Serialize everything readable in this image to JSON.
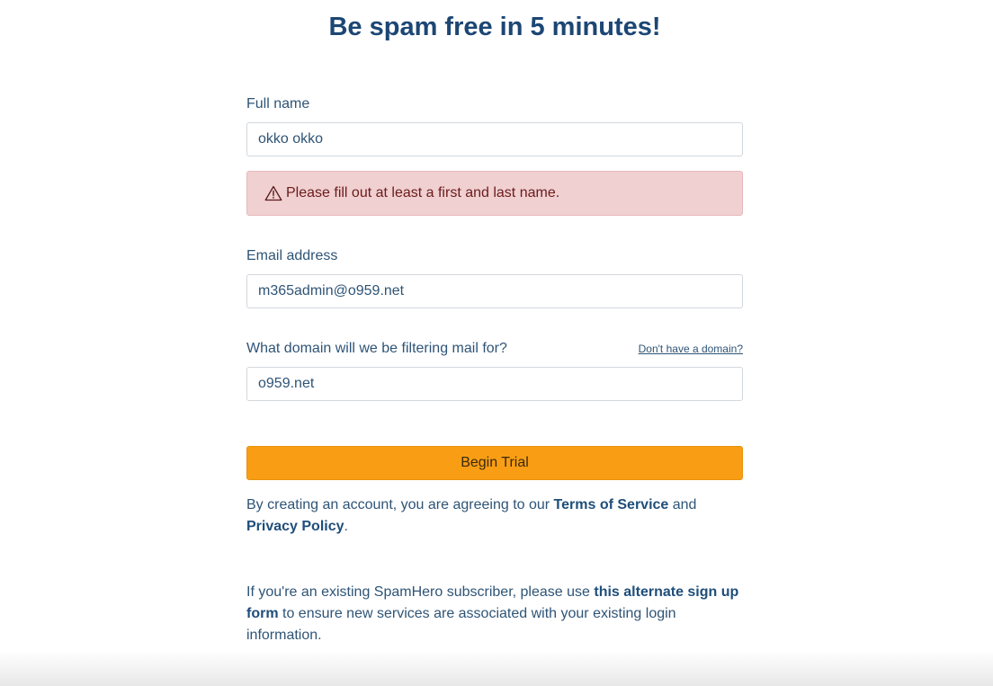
{
  "page": {
    "title": "Be spam free in 5 minutes!"
  },
  "form": {
    "full_name": {
      "label": "Full name",
      "value": "okko okko"
    },
    "name_error": {
      "icon": "warning-icon",
      "message": "Please fill out at least a first and last name."
    },
    "email": {
      "label": "Email address",
      "value": "m365admin@o959.net"
    },
    "domain": {
      "label": "What domain will we be filtering mail for?",
      "help_link": "Don't have a domain?",
      "value": "o959.net"
    },
    "submit_label": "Begin Trial"
  },
  "agreement": {
    "prefix": "By creating an account, you are agreeing to our ",
    "terms_link": "Terms of Service",
    "middle": " and ",
    "privacy_link": "Privacy Policy",
    "suffix": "."
  },
  "existing": {
    "prefix": "If you're an existing SpamHero subscriber, please use ",
    "link": "this alternate sign up form",
    "suffix": " to ensure new services are associated with your existing login information."
  },
  "colors": {
    "title": "#1c4674",
    "button": "#f99e14",
    "alert_bg": "#f0d0d1",
    "alert_text": "#6b1b1b"
  }
}
